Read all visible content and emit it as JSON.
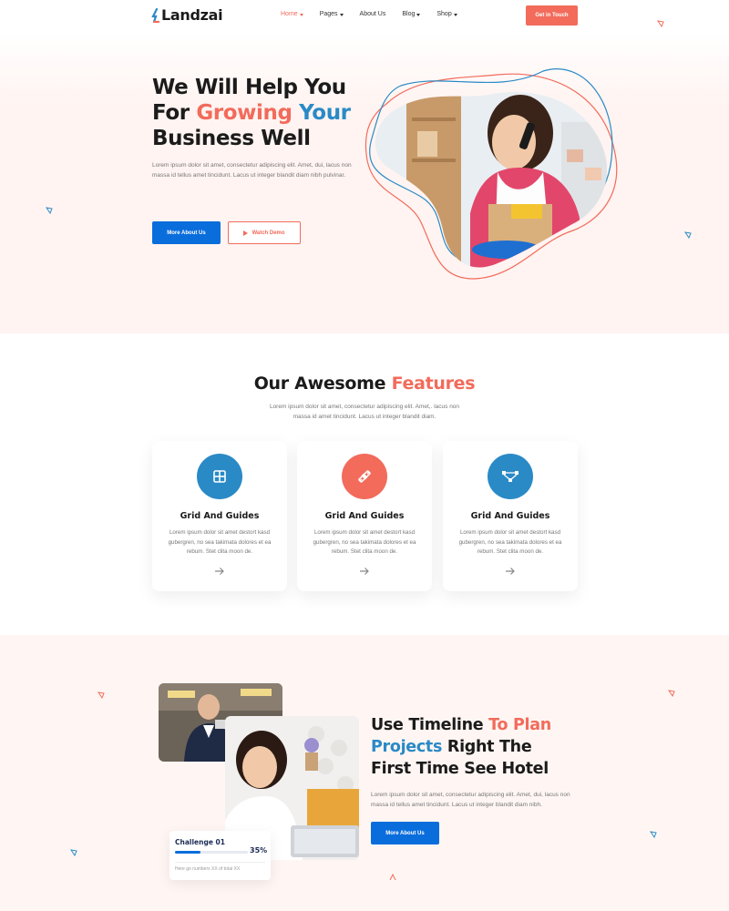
{
  "header": {
    "logo_text": "Landzai",
    "nav": [
      {
        "label": "Home",
        "dropdown": true,
        "active": true
      },
      {
        "label": "Pages",
        "dropdown": true,
        "active": false
      },
      {
        "label": "About Us",
        "dropdown": false,
        "active": false
      },
      {
        "label": "Blog",
        "dropdown": true,
        "active": false
      },
      {
        "label": "Shop",
        "dropdown": true,
        "active": false
      }
    ],
    "cta_label": "Get in Touch"
  },
  "hero": {
    "title_line1": "We Will Help You",
    "title_line2_a": "For ",
    "title_line2_b": "Growing",
    "title_line2_c": " Your",
    "title_line3": "Business Well",
    "description": "Lorem ipsum dolor sit amet, consectetur adipiscing elit. Amet, dui, lacus non massa id tellus amet tincidunt. Lacus ut integer blandit diam nibh pulvinar.",
    "primary_button": "More About Us",
    "secondary_button": "Watch Demo"
  },
  "features": {
    "title_a": "Our Awesome ",
    "title_b": "Features",
    "description": "Lorem ipsum dolor sit amet, consectetur adipiscing elit. Amet,. lacus non massa id amet tincidunt. Lacus ut integer blandit diam.",
    "cards": [
      {
        "icon": "grid-icon",
        "color": "#2a8ac6",
        "title": "Grid And Guides",
        "description": "Lorem ipsum dolor sit amet destort kasd gubergren, no sea takimata dolores et ea rebum. Stet clita moon de."
      },
      {
        "icon": "pencil-ruler-icon",
        "color": "#f26b5b",
        "title": "Grid And Guides",
        "description": "Lorem ipsum dolor sit amet destort kasd gubergren, no sea takimata dolores et ea rebum. Stet clita moon de."
      },
      {
        "icon": "vector-nodes-icon",
        "color": "#2a8ac6",
        "title": "Grid And Guides",
        "description": "Lorem ipsum dolor sit amet destort kasd gubergren, no sea takimata dolores et ea rebum. Stet clita moon de."
      }
    ]
  },
  "timeline": {
    "title_line1_a": "Use Timeline ",
    "title_line1_b": "To Plan",
    "title_line2_a": "Projects",
    "title_line2_b": " Right The",
    "title_line3": "First Time See Hotel",
    "description": "Lorem ipsum dolor sit amet, consectetur adipiscing elit. Amet, dui, lacus non massa id tellus amet tincidunt. Lacus ut integer blandit diam nibh.",
    "button": "More About Us",
    "challenge": {
      "title": "Challenge 01",
      "percent_label": "35%",
      "progress": 0.35,
      "note": "Here go numbers XX of total XX"
    }
  },
  "colors": {
    "accent": "#f26b5b",
    "primary": "#0a6ddc",
    "secondary_blue": "#2a8ac6"
  }
}
